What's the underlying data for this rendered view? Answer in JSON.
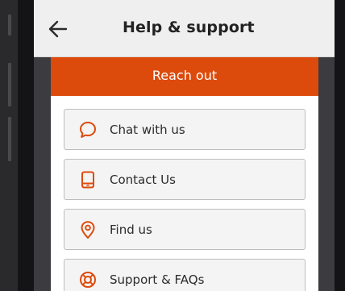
{
  "app_bar": {
    "title": "Help & support",
    "back_icon": "arrow-left-icon"
  },
  "panel": {
    "header": "Reach out",
    "accent_color": "#dd4b0c",
    "options": [
      {
        "label": "Chat with us",
        "icon": "chat-bubble-icon"
      },
      {
        "label": "Contact Us",
        "icon": "phone-icon"
      },
      {
        "label": "Find us",
        "icon": "location-pin-icon"
      },
      {
        "label": "Support & FAQs",
        "icon": "lifebuoy-icon"
      }
    ]
  }
}
